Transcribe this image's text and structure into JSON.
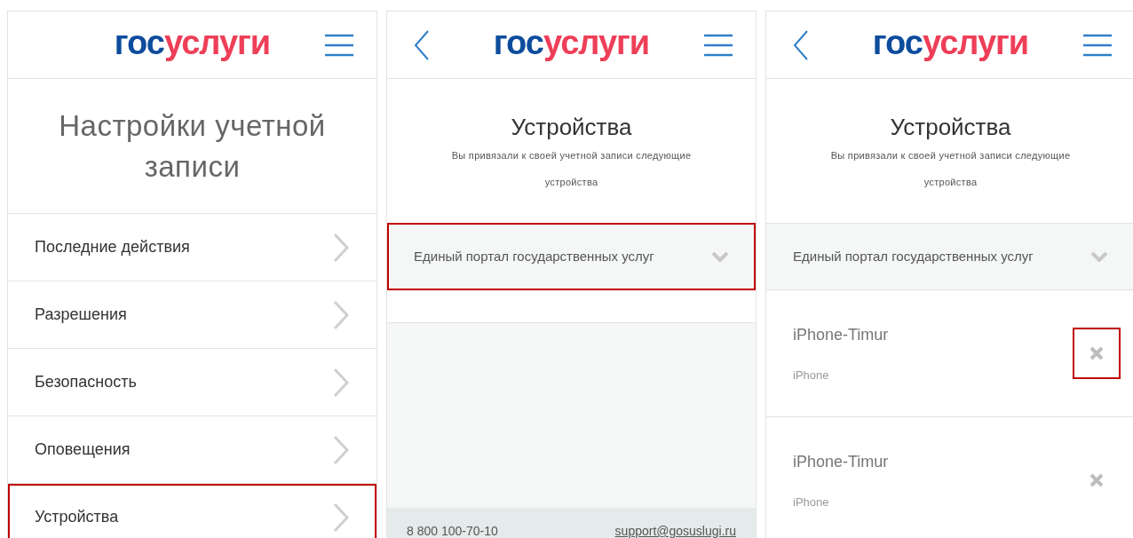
{
  "screens": [
    {
      "kind": "menu",
      "header": {
        "back_button": false,
        "logo": {
          "first": "гос",
          "second": "услуги"
        }
      },
      "title": "Настройки учетной записи",
      "items": [
        {
          "label": "Последние действия",
          "highlighted": false
        },
        {
          "label": "Разрешения",
          "highlighted": false
        },
        {
          "label": "Безопасность",
          "highlighted": false
        },
        {
          "label": "Оповещения",
          "highlighted": false
        },
        {
          "label": "Устройства",
          "highlighted": true
        }
      ]
    },
    {
      "kind": "devices",
      "header": {
        "back_button": true,
        "logo": {
          "first": "гос",
          "second": "услуги"
        }
      },
      "title": "Устройства",
      "subtitle": "Вы привязали к своей учетной записи следующие устройства",
      "portal": {
        "label": "Единый портал государственных услуг",
        "highlighted": true
      },
      "footer": {
        "phone": "8 800 100-70-10",
        "email": "support@gosuslugi.ru"
      }
    },
    {
      "kind": "devices",
      "header": {
        "back_button": true,
        "logo": {
          "first": "гос",
          "second": "услуги"
        }
      },
      "title": "Устройства",
      "subtitle": "Вы привязали к своей учетной записи следующие устройства",
      "portal": {
        "label": "Единый портал государственных услуг",
        "highlighted": false
      },
      "devices": [
        {
          "name": "iPhone-Timur",
          "type": "iPhone",
          "highlighted": true
        },
        {
          "name": "iPhone-Timur",
          "type": "iPhone",
          "highlighted": false
        }
      ]
    }
  ]
}
